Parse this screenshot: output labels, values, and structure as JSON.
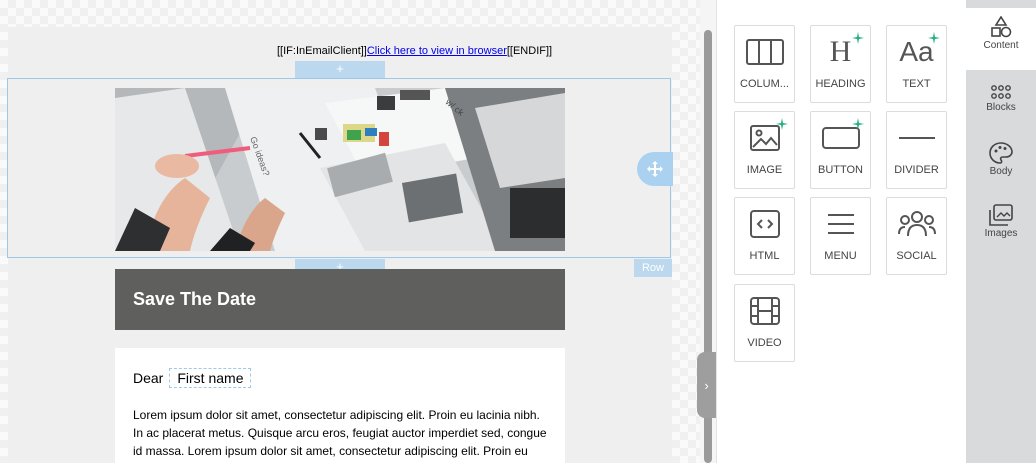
{
  "email": {
    "browser_prefix": "[[IF:InEmailClient]]",
    "browser_link": "Click here to view in browser",
    "browser_suffix": "[[ENDIF]]",
    "add_symbol": "+",
    "row_label": "Row",
    "save_the_date": "Save The Date",
    "dear": "Dear",
    "first_name_tag": "First name",
    "body_text": "Lorem ipsum dolor sit amet, consectetur adipiscing elit. Proin eu lacinia nibh. In ac placerat metus. Quisque arcu eros, feugiat auctor imperdiet sed, congue id massa. Lorem ipsum dolor sit amet, consectetur adipiscing elit. Proin eu lacinia nibh. In ac placerat metus. Quisque arcu eros, feugiat"
  },
  "panel": {
    "tiles": [
      {
        "label": "COLUM...",
        "icon": "columns-icon"
      },
      {
        "label": "HEADING",
        "icon": "heading-icon"
      },
      {
        "label": "TEXT",
        "icon": "text-icon"
      },
      {
        "label": "IMAGE",
        "icon": "image-icon"
      },
      {
        "label": "BUTTON",
        "icon": "button-icon"
      },
      {
        "label": "DIVIDER",
        "icon": "divider-icon"
      },
      {
        "label": "HTML",
        "icon": "html-icon"
      },
      {
        "label": "MENU",
        "icon": "menu-icon"
      },
      {
        "label": "SOCIAL",
        "icon": "social-icon"
      },
      {
        "label": "VIDEO",
        "icon": "video-icon"
      }
    ],
    "heading_glyph": "H",
    "text_glyph": "Aa"
  },
  "sidenav": {
    "items": [
      {
        "label": "Content",
        "icon": "shapes-icon"
      },
      {
        "label": "Blocks",
        "icon": "grid-dots-icon"
      },
      {
        "label": "Body",
        "icon": "palette-icon"
      },
      {
        "label": "Images",
        "icon": "images-icon"
      }
    ]
  },
  "colors": {
    "accent": "#20b27d",
    "selection": "#9cc9ea",
    "header_bar": "#5f5f5e"
  }
}
